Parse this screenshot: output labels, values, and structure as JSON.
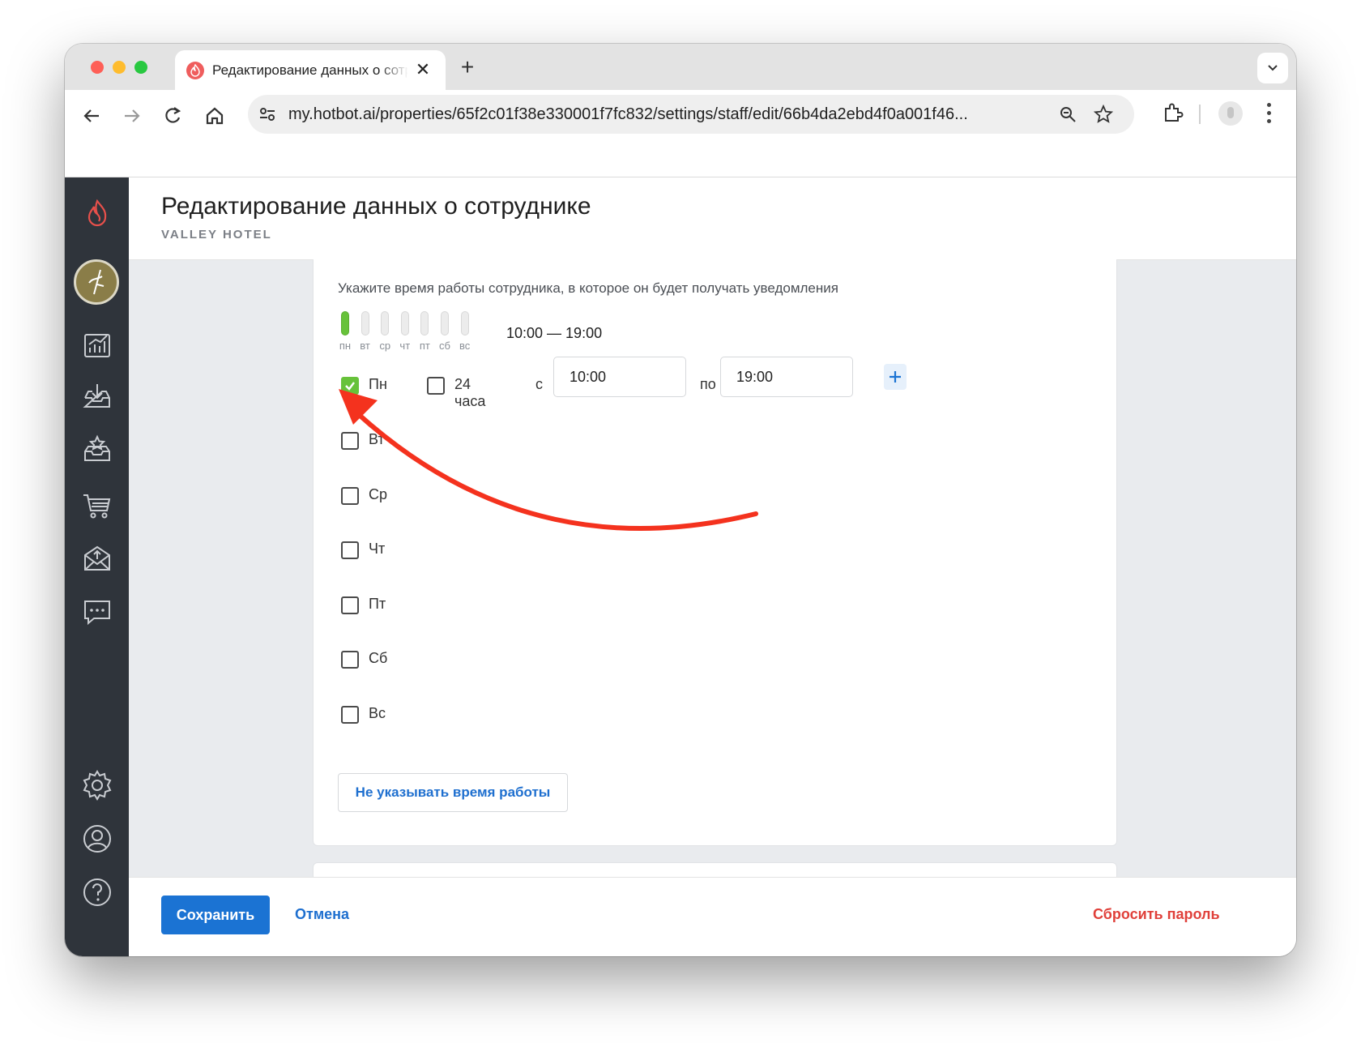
{
  "browser": {
    "tab_title": "Редактирование данных о сотруднике",
    "url": "my.hotbot.ai/properties/65f2c01f38e330001f7fc832/settings/staff/edit/66b4da2ebd4f0a001f46..."
  },
  "header": {
    "title": "Редактирование данных о сотруднике",
    "subtitle": "VALLEY HOTEL"
  },
  "schedule": {
    "hint": "Укажите время работы сотрудника, в которое он будет получать уведомления",
    "week_labels": [
      "пн",
      "вт",
      "ср",
      "чт",
      "пт",
      "сб",
      "вс"
    ],
    "week_active": [
      true,
      false,
      false,
      false,
      false,
      false,
      false
    ],
    "summary": "10:00 — 19:00",
    "days": [
      {
        "label": "Пн",
        "checked": true
      },
      {
        "label": "Вт",
        "checked": false
      },
      {
        "label": "Ср",
        "checked": false
      },
      {
        "label": "Чт",
        "checked": false
      },
      {
        "label": "Пт",
        "checked": false
      },
      {
        "label": "Сб",
        "checked": false
      },
      {
        "label": "Вс",
        "checked": false
      }
    ],
    "all_day_label": "24 часа",
    "from_label": "с",
    "from_value": "10:00",
    "to_label": "по",
    "to_value": "19:00",
    "clear_label": "Не указывать время работы"
  },
  "footer": {
    "save_label": "Сохранить",
    "cancel_label": "Отмена",
    "reset_label": "Сбросить пароль"
  },
  "colors": {
    "accent": "#1b73d3",
    "active_day": "#67c23a",
    "danger": "#e0403a",
    "sidebar": "#2f343b",
    "annotation_arrow": "#f4321e"
  },
  "sidebar_icons": [
    "hotbot-flame-icon",
    "avatar",
    "analytics-icon",
    "inbox-download-icon",
    "reviews-icon",
    "cart-icon",
    "mail-upload-icon",
    "chat-icon",
    "settings-icon",
    "user-icon",
    "help-icon"
  ]
}
